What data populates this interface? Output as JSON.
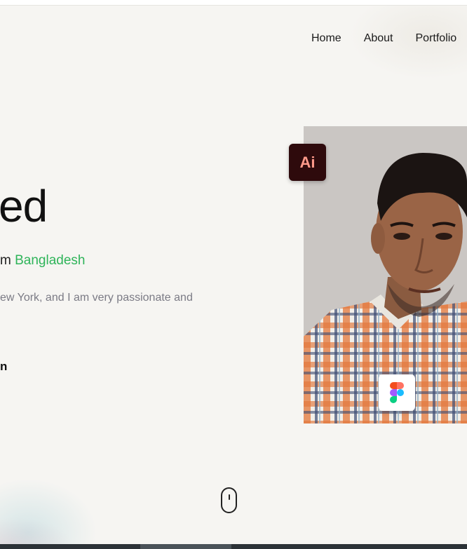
{
  "nav": {
    "items": [
      {
        "label": "Home"
      },
      {
        "label": "About"
      },
      {
        "label": "Portfolio"
      }
    ]
  },
  "hero": {
    "name_fragment": "ed",
    "from_prefix": "m",
    "country": "Bangladesh",
    "description": "ew York, and I am very passionate and",
    "cta": "n"
  },
  "badges": {
    "ai_text": "Ai",
    "ai_icon": "adobe-illustrator-icon",
    "figma_icon": "figma-icon"
  },
  "colors": {
    "accent_green": "#2fb45a",
    "ai_badge_bg": "#2e0a0c",
    "ai_badge_text": "#ff9a8a"
  }
}
